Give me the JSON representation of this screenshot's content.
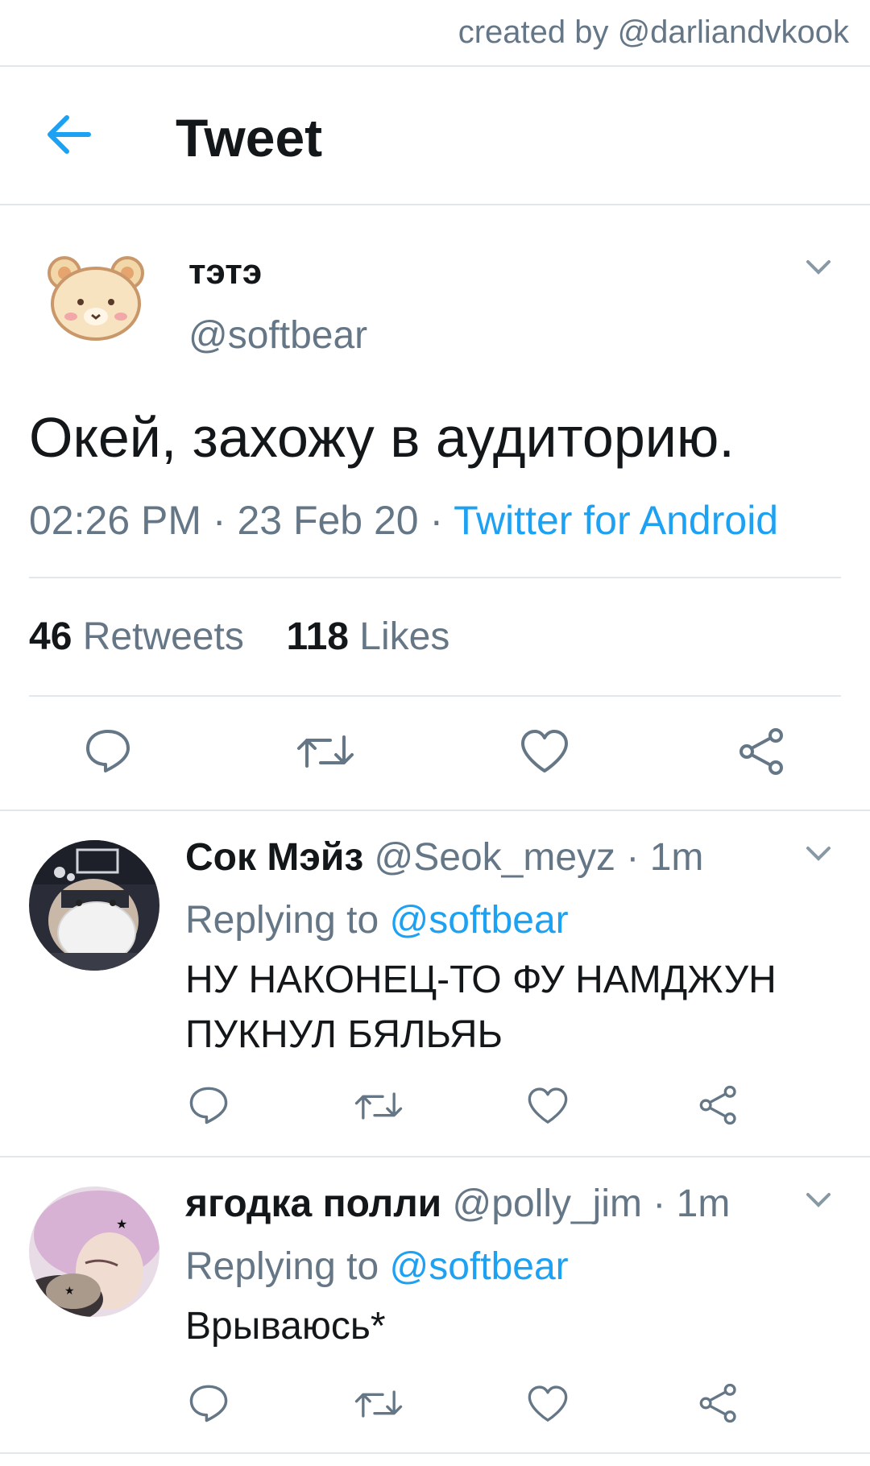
{
  "credit": "created by @darliandvkook",
  "header": {
    "title": "Tweet"
  },
  "tweet": {
    "name": "тэтэ",
    "handle": "@softbear",
    "text": "Окей, захожу в аудиторию.",
    "time": "02:26 PM · 23 Feb 20 · ",
    "source": "Twitter for Android",
    "retweets_count": "46",
    "retweets_label": "Retweets",
    "likes_count": "118",
    "likes_label": "Likes"
  },
  "replies": [
    {
      "name": "Сок Мэйз",
      "handle": "@Seok_meyz · 1m",
      "replying_label": "Replying to",
      "replying_to": "@softbear",
      "text": "НУ НАКОНЕЦ-ТО ФУ НАМДЖУН ПУКНУЛ БЯЛЬЯЬ"
    },
    {
      "name": "ягодка полли",
      "handle": "@polly_jim · 1m",
      "replying_label": "Replying to",
      "replying_to": "@softbear",
      "text": "Врываюсь*"
    }
  ],
  "colors": {
    "accent": "#1da1f2",
    "secondary": "#657786",
    "divider": "#e1e8ed"
  },
  "icons": [
    "back-arrow-icon",
    "chevron-down-icon",
    "reply-icon",
    "retweet-icon",
    "like-icon",
    "share-icon"
  ]
}
